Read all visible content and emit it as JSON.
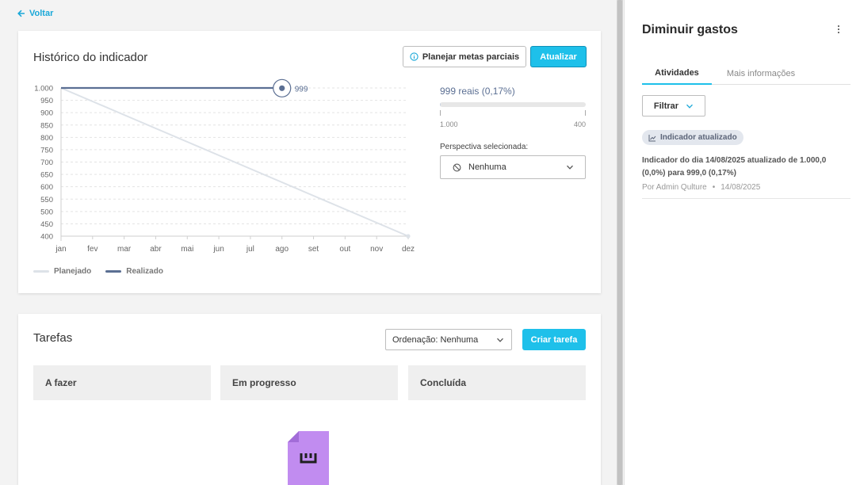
{
  "nav": {
    "back_label": "Voltar"
  },
  "history": {
    "title": "Histórico do indicador",
    "plan_button_label": "Planejar metas parciais",
    "update_button_label": "Atualizar",
    "value_summary": "999 reais (0,17%)",
    "progress": {
      "start_label": "1.000",
      "end_label": "400",
      "fraction": 0.0017
    },
    "perspective_label": "Perspectiva selecionada:",
    "perspective_value": "Nenhuma",
    "legend": [
      {
        "label": "Planejado",
        "color": "#dde2e8"
      },
      {
        "label": "Realizado",
        "color": "#5b6f93"
      }
    ]
  },
  "chart_data": {
    "type": "line",
    "categories": [
      "jan",
      "fev",
      "mar",
      "abr",
      "mai",
      "jun",
      "jul",
      "ago",
      "set",
      "out",
      "nov",
      "dez"
    ],
    "yticks": [
      "1.000",
      "950",
      "900",
      "850",
      "800",
      "750",
      "700",
      "650",
      "600",
      "550",
      "500",
      "450",
      "400"
    ],
    "ylim": [
      400,
      1000
    ],
    "grid": true,
    "series": [
      {
        "name": "Planejado",
        "color": "#dde2e8",
        "values": [
          1000,
          945.45,
          890.91,
          836.36,
          781.82,
          727.27,
          672.73,
          618.18,
          563.64,
          509.09,
          454.55,
          400
        ]
      },
      {
        "name": "Realizado",
        "color": "#5b6f93",
        "values": [
          1000,
          1000,
          1000,
          1000,
          1000,
          1000,
          1000,
          1000
        ]
      }
    ],
    "annotation": {
      "label": "999",
      "category": "ago",
      "value": 999
    }
  },
  "tasks": {
    "title": "Tarefas",
    "sort_label": "Ordenação: Nenhuma",
    "create_button_label": "Criar tarefa",
    "columns": [
      {
        "label": "A fazer"
      },
      {
        "label": "Em progresso"
      },
      {
        "label": "Concluída"
      }
    ]
  },
  "panel": {
    "title": "Diminuir gastos",
    "tabs": [
      {
        "label": "Atividades"
      },
      {
        "label": "Mais informações"
      }
    ],
    "filter_label": "Filtrar",
    "activity": {
      "badge": "Indicador atualizado",
      "text": "Indicador do dia 14/08/2025 atualizado de 1.000,0 (0,0%) para 999,0 (0,17%)",
      "author": "Por Admin Qulture",
      "date": "14/08/2025"
    }
  },
  "colors": {
    "accent": "#1ec0ea",
    "link": "#1aa8d8",
    "realized": "#5b6f93",
    "planned": "#dde2e8",
    "illustration": "#c18cf0"
  },
  "icons": [
    "arrow-left-icon",
    "info-icon",
    "ban-icon",
    "chevron-down-icon",
    "kebab-icon",
    "trend-icon",
    "document-icon"
  ]
}
